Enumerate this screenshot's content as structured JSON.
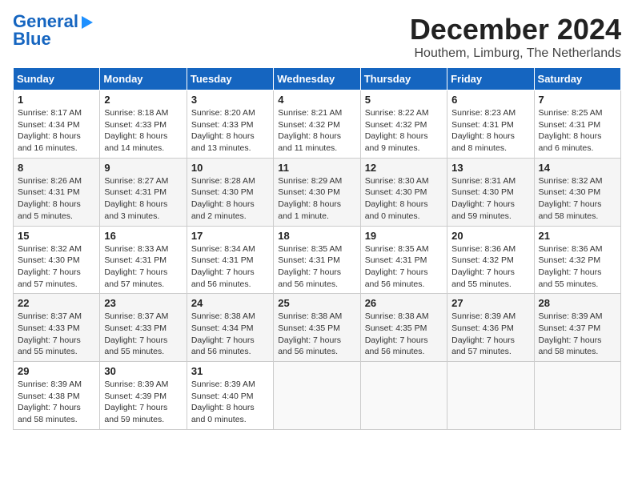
{
  "header": {
    "logo_line1": "General",
    "logo_line2": "Blue",
    "month_title": "December 2024",
    "subtitle": "Houthem, Limburg, The Netherlands"
  },
  "days_of_week": [
    "Sunday",
    "Monday",
    "Tuesday",
    "Wednesday",
    "Thursday",
    "Friday",
    "Saturday"
  ],
  "weeks": [
    [
      {
        "day": "1",
        "sunrise": "Sunrise: 8:17 AM",
        "sunset": "Sunset: 4:34 PM",
        "daylight": "Daylight: 8 hours and 16 minutes."
      },
      {
        "day": "2",
        "sunrise": "Sunrise: 8:18 AM",
        "sunset": "Sunset: 4:33 PM",
        "daylight": "Daylight: 8 hours and 14 minutes."
      },
      {
        "day": "3",
        "sunrise": "Sunrise: 8:20 AM",
        "sunset": "Sunset: 4:33 PM",
        "daylight": "Daylight: 8 hours and 13 minutes."
      },
      {
        "day": "4",
        "sunrise": "Sunrise: 8:21 AM",
        "sunset": "Sunset: 4:32 PM",
        "daylight": "Daylight: 8 hours and 11 minutes."
      },
      {
        "day": "5",
        "sunrise": "Sunrise: 8:22 AM",
        "sunset": "Sunset: 4:32 PM",
        "daylight": "Daylight: 8 hours and 9 minutes."
      },
      {
        "day": "6",
        "sunrise": "Sunrise: 8:23 AM",
        "sunset": "Sunset: 4:31 PM",
        "daylight": "Daylight: 8 hours and 8 minutes."
      },
      {
        "day": "7",
        "sunrise": "Sunrise: 8:25 AM",
        "sunset": "Sunset: 4:31 PM",
        "daylight": "Daylight: 8 hours and 6 minutes."
      }
    ],
    [
      {
        "day": "8",
        "sunrise": "Sunrise: 8:26 AM",
        "sunset": "Sunset: 4:31 PM",
        "daylight": "Daylight: 8 hours and 5 minutes."
      },
      {
        "day": "9",
        "sunrise": "Sunrise: 8:27 AM",
        "sunset": "Sunset: 4:31 PM",
        "daylight": "Daylight: 8 hours and 3 minutes."
      },
      {
        "day": "10",
        "sunrise": "Sunrise: 8:28 AM",
        "sunset": "Sunset: 4:30 PM",
        "daylight": "Daylight: 8 hours and 2 minutes."
      },
      {
        "day": "11",
        "sunrise": "Sunrise: 8:29 AM",
        "sunset": "Sunset: 4:30 PM",
        "daylight": "Daylight: 8 hours and 1 minute."
      },
      {
        "day": "12",
        "sunrise": "Sunrise: 8:30 AM",
        "sunset": "Sunset: 4:30 PM",
        "daylight": "Daylight: 8 hours and 0 minutes."
      },
      {
        "day": "13",
        "sunrise": "Sunrise: 8:31 AM",
        "sunset": "Sunset: 4:30 PM",
        "daylight": "Daylight: 7 hours and 59 minutes."
      },
      {
        "day": "14",
        "sunrise": "Sunrise: 8:32 AM",
        "sunset": "Sunset: 4:30 PM",
        "daylight": "Daylight: 7 hours and 58 minutes."
      }
    ],
    [
      {
        "day": "15",
        "sunrise": "Sunrise: 8:32 AM",
        "sunset": "Sunset: 4:30 PM",
        "daylight": "Daylight: 7 hours and 57 minutes."
      },
      {
        "day": "16",
        "sunrise": "Sunrise: 8:33 AM",
        "sunset": "Sunset: 4:31 PM",
        "daylight": "Daylight: 7 hours and 57 minutes."
      },
      {
        "day": "17",
        "sunrise": "Sunrise: 8:34 AM",
        "sunset": "Sunset: 4:31 PM",
        "daylight": "Daylight: 7 hours and 56 minutes."
      },
      {
        "day": "18",
        "sunrise": "Sunrise: 8:35 AM",
        "sunset": "Sunset: 4:31 PM",
        "daylight": "Daylight: 7 hours and 56 minutes."
      },
      {
        "day": "19",
        "sunrise": "Sunrise: 8:35 AM",
        "sunset": "Sunset: 4:31 PM",
        "daylight": "Daylight: 7 hours and 56 minutes."
      },
      {
        "day": "20",
        "sunrise": "Sunrise: 8:36 AM",
        "sunset": "Sunset: 4:32 PM",
        "daylight": "Daylight: 7 hours and 55 minutes."
      },
      {
        "day": "21",
        "sunrise": "Sunrise: 8:36 AM",
        "sunset": "Sunset: 4:32 PM",
        "daylight": "Daylight: 7 hours and 55 minutes."
      }
    ],
    [
      {
        "day": "22",
        "sunrise": "Sunrise: 8:37 AM",
        "sunset": "Sunset: 4:33 PM",
        "daylight": "Daylight: 7 hours and 55 minutes."
      },
      {
        "day": "23",
        "sunrise": "Sunrise: 8:37 AM",
        "sunset": "Sunset: 4:33 PM",
        "daylight": "Daylight: 7 hours and 55 minutes."
      },
      {
        "day": "24",
        "sunrise": "Sunrise: 8:38 AM",
        "sunset": "Sunset: 4:34 PM",
        "daylight": "Daylight: 7 hours and 56 minutes."
      },
      {
        "day": "25",
        "sunrise": "Sunrise: 8:38 AM",
        "sunset": "Sunset: 4:35 PM",
        "daylight": "Daylight: 7 hours and 56 minutes."
      },
      {
        "day": "26",
        "sunrise": "Sunrise: 8:38 AM",
        "sunset": "Sunset: 4:35 PM",
        "daylight": "Daylight: 7 hours and 56 minutes."
      },
      {
        "day": "27",
        "sunrise": "Sunrise: 8:39 AM",
        "sunset": "Sunset: 4:36 PM",
        "daylight": "Daylight: 7 hours and 57 minutes."
      },
      {
        "day": "28",
        "sunrise": "Sunrise: 8:39 AM",
        "sunset": "Sunset: 4:37 PM",
        "daylight": "Daylight: 7 hours and 58 minutes."
      }
    ],
    [
      {
        "day": "29",
        "sunrise": "Sunrise: 8:39 AM",
        "sunset": "Sunset: 4:38 PM",
        "daylight": "Daylight: 7 hours and 58 minutes."
      },
      {
        "day": "30",
        "sunrise": "Sunrise: 8:39 AM",
        "sunset": "Sunset: 4:39 PM",
        "daylight": "Daylight: 7 hours and 59 minutes."
      },
      {
        "day": "31",
        "sunrise": "Sunrise: 8:39 AM",
        "sunset": "Sunset: 4:40 PM",
        "daylight": "Daylight: 8 hours and 0 minutes."
      },
      null,
      null,
      null,
      null
    ]
  ]
}
